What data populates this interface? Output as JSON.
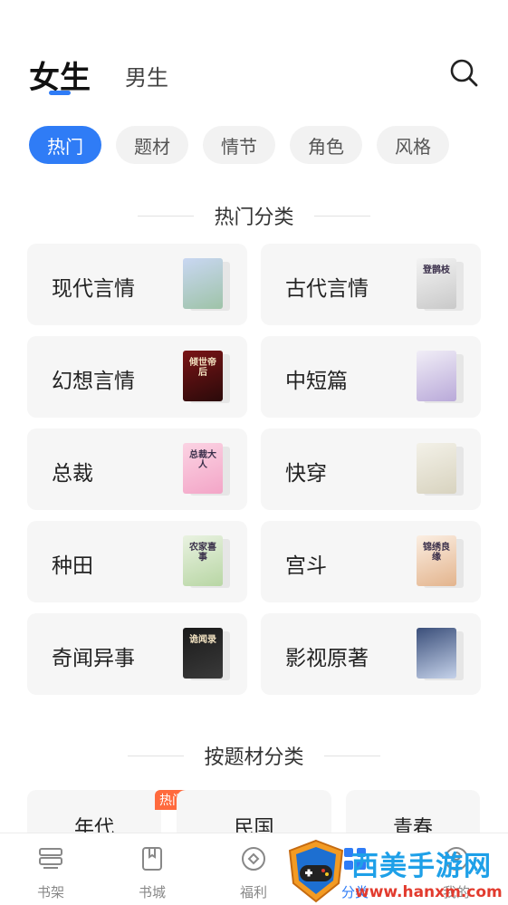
{
  "header": {
    "tabs": [
      {
        "label": "女生",
        "active": true
      },
      {
        "label": "男生",
        "active": false
      }
    ],
    "search_icon": "search-icon"
  },
  "chips": [
    "热门",
    "题材",
    "情节",
    "角色",
    "风格"
  ],
  "hot_section": {
    "title": "热门分类",
    "categories": [
      {
        "label": "现代言情",
        "cover_text": "",
        "cover_colors": [
          "#c9d7f2",
          "#9ec3a8"
        ]
      },
      {
        "label": "古代言情",
        "cover_text": "登鹊枝",
        "cover_colors": [
          "#f3f3f3",
          "#c9c9c9"
        ]
      },
      {
        "label": "幻想言情",
        "cover_text": "倾世帝后",
        "cover_colors": [
          "#7a1416",
          "#2a0a0a"
        ]
      },
      {
        "label": "中短篇",
        "cover_text": "",
        "cover_colors": [
          "#f1eef7",
          "#b9a9d9"
        ]
      },
      {
        "label": "总裁",
        "cover_text": "总裁大人",
        "cover_colors": [
          "#fbd3e3",
          "#f3a5c7"
        ]
      },
      {
        "label": "快穿",
        "cover_text": "",
        "cover_colors": [
          "#f3f1e8",
          "#d8d3bf"
        ]
      },
      {
        "label": "种田",
        "cover_text": "农家喜事",
        "cover_colors": [
          "#e9f2e1",
          "#b8d6a4"
        ]
      },
      {
        "label": "宫斗",
        "cover_text": "锦绣良缘",
        "cover_colors": [
          "#fbeee2",
          "#e3b48d"
        ]
      },
      {
        "label": "奇闻异事",
        "cover_text": "诡闻录",
        "cover_colors": [
          "#1a1a1a",
          "#3a3a3a"
        ]
      },
      {
        "label": "影视原著",
        "cover_text": "",
        "cover_colors": [
          "#3b4f7a",
          "#c5d2ea"
        ]
      }
    ]
  },
  "theme_section": {
    "title": "按题材分类",
    "items": [
      {
        "label": "年代",
        "badge": "热门"
      },
      {
        "label": "民国",
        "badge": ""
      },
      {
        "label": "青春",
        "badge": ""
      }
    ]
  },
  "bottom_nav": [
    {
      "label": "书架",
      "icon": "bookshelf-icon",
      "active": false
    },
    {
      "label": "书城",
      "icon": "bookstore-icon",
      "active": false
    },
    {
      "label": "福利",
      "icon": "welfare-icon",
      "active": false
    },
    {
      "label": "分类",
      "icon": "category-icon",
      "active": true
    },
    {
      "label": "我的",
      "icon": "profile-icon",
      "active": false
    }
  ],
  "watermark": {
    "title": "西美手游网",
    "url": "www.hanxm.com"
  },
  "colors": {
    "accent": "#2f7cf6",
    "chip_bg": "#f2f2f2",
    "card_bg": "#f6f6f6",
    "badge": "#ff6a3d"
  }
}
